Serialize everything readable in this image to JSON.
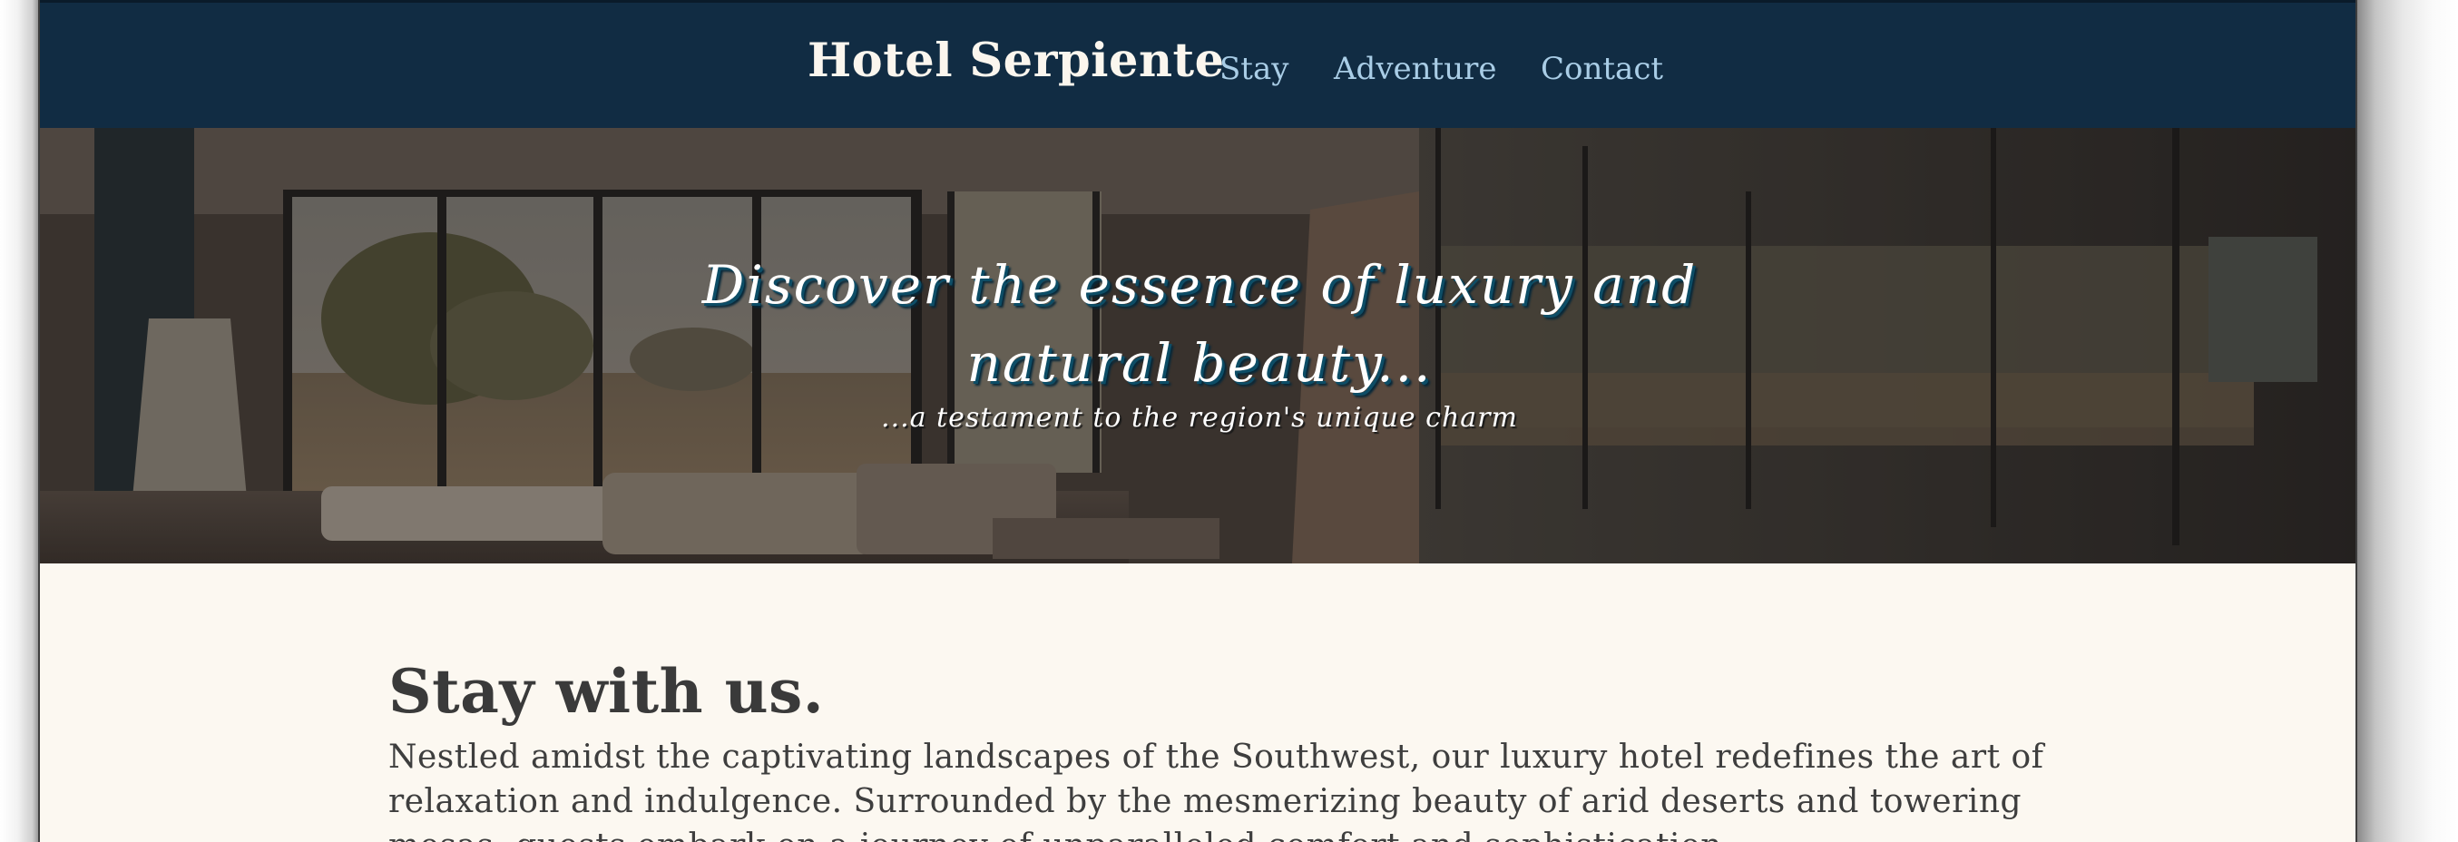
{
  "header": {
    "brand": "Hotel Serpiente",
    "nav": [
      {
        "label": "Stay"
      },
      {
        "label": "Adventure"
      },
      {
        "label": "Contact"
      }
    ]
  },
  "hero": {
    "title_line1": "Discover the essence of luxury and",
    "title_line2": "natural beauty...",
    "subtitle": "...a testament to the region's unique charm"
  },
  "section": {
    "heading": "Stay with us.",
    "body": "Nestled amidst the captivating landscapes of the Southwest, our luxury hotel redefines the art of relaxation and indulgence. Surrounded by the mesmerizing beauty of arid deserts and towering mesas, guests embark on a journey of unparalleled comfort and sophistication."
  },
  "colors": {
    "header_bg": "#112c43",
    "nav_link": "#a9cde6",
    "brand_text": "#fbf6ee",
    "page_bg": "#fcf8f1",
    "body_text": "#3e3e3e"
  }
}
